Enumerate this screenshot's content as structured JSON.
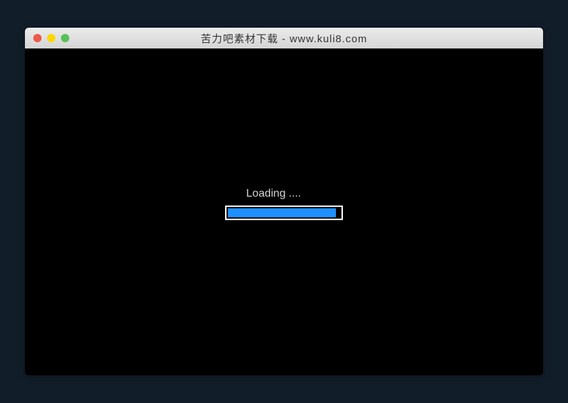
{
  "window": {
    "title": "苦力吧素材下载 - www.kuli8.com"
  },
  "loading": {
    "label": "Loading ....",
    "progress_percent": 96
  },
  "colors": {
    "page_bg": "#111d29",
    "window_bg": "#000000",
    "progress_fill": "#1e90ff",
    "progress_border": "#ffffff",
    "traffic_red": "#ed594a",
    "traffic_yellow": "#fdd800",
    "traffic_green": "#5ac05a"
  }
}
